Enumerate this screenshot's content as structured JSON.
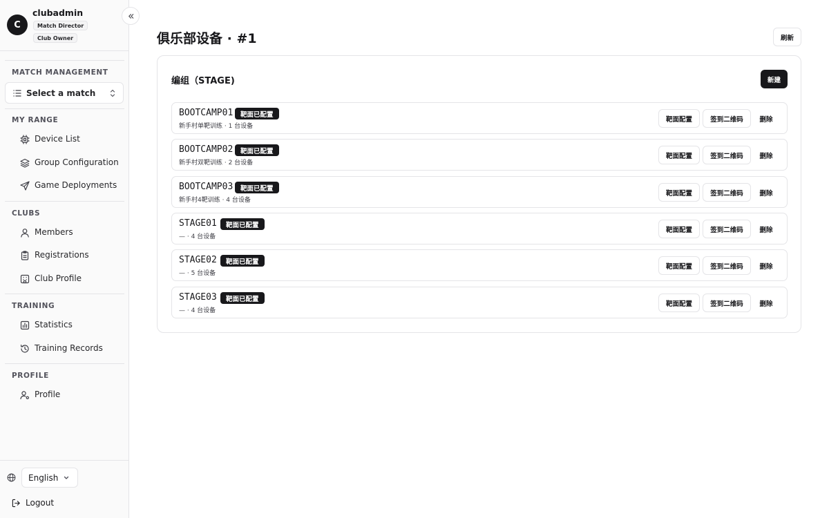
{
  "user": {
    "avatar_letter": "C",
    "name": "clubadmin",
    "roles": [
      "Match Director",
      "Club Owner"
    ]
  },
  "sidebar": {
    "sections": {
      "match_management": "MATCH MANAGEMENT",
      "my_range": "MY RANGE",
      "clubs": "CLUBS",
      "training": "TRAINING",
      "profile": "PROFILE"
    },
    "match_select_placeholder": "Select a match",
    "items": {
      "device_list": "Device List",
      "group_configuration": "Group Configuration",
      "game_deployments": "Game Deployments",
      "members": "Members",
      "registrations": "Registrations",
      "club_profile": "Club Profile",
      "statistics": "Statistics",
      "training_records": "Training Records",
      "profile": "Profile"
    },
    "language": "English",
    "logout": "Logout"
  },
  "main": {
    "title": "俱乐部设备 · #1",
    "refresh_label": "刷新",
    "card_title": "编组（STAGE)",
    "new_label": "新建",
    "row_actions": {
      "target_config": "靶面配置",
      "checkin_qr": "签到二维码",
      "delete": "删除"
    },
    "stages": [
      {
        "code": "BOOTCAMP01",
        "badge": "靶面已配置",
        "subtitle": "新手村单靶训练 · 1 台设备"
      },
      {
        "code": "BOOTCAMP02",
        "badge": "靶面已配置",
        "subtitle": "新手村双靶训练 · 2 台设备"
      },
      {
        "code": "BOOTCAMP03",
        "badge": "靶面已配置",
        "subtitle": "新手村4靶训练 · 4 台设备"
      },
      {
        "code": "STAGE01",
        "badge": "靶面已配置",
        "subtitle": "— · 4 台设备"
      },
      {
        "code": "STAGE02",
        "badge": "靶面已配置",
        "subtitle": "— · 5 台设备"
      },
      {
        "code": "STAGE03",
        "badge": "靶面已配置",
        "subtitle": "— · 4 台设备"
      }
    ]
  },
  "icons": {
    "collapse": "chevrons-left-icon",
    "match_select": "list-icon",
    "match_select_chevron": "chevrons-up-down-icon",
    "device_list": "cpu-icon",
    "group_configuration": "layers-icon",
    "game_deployments": "send-icon",
    "members": "user-icon",
    "registrations": "clipboard-icon",
    "club_profile": "building-icon",
    "statistics": "bar-chart-icon",
    "training_records": "history-icon",
    "profile": "user-cog-icon",
    "language": "globe-icon",
    "language_chevron": "chevron-down-icon",
    "logout": "log-out-icon"
  }
}
